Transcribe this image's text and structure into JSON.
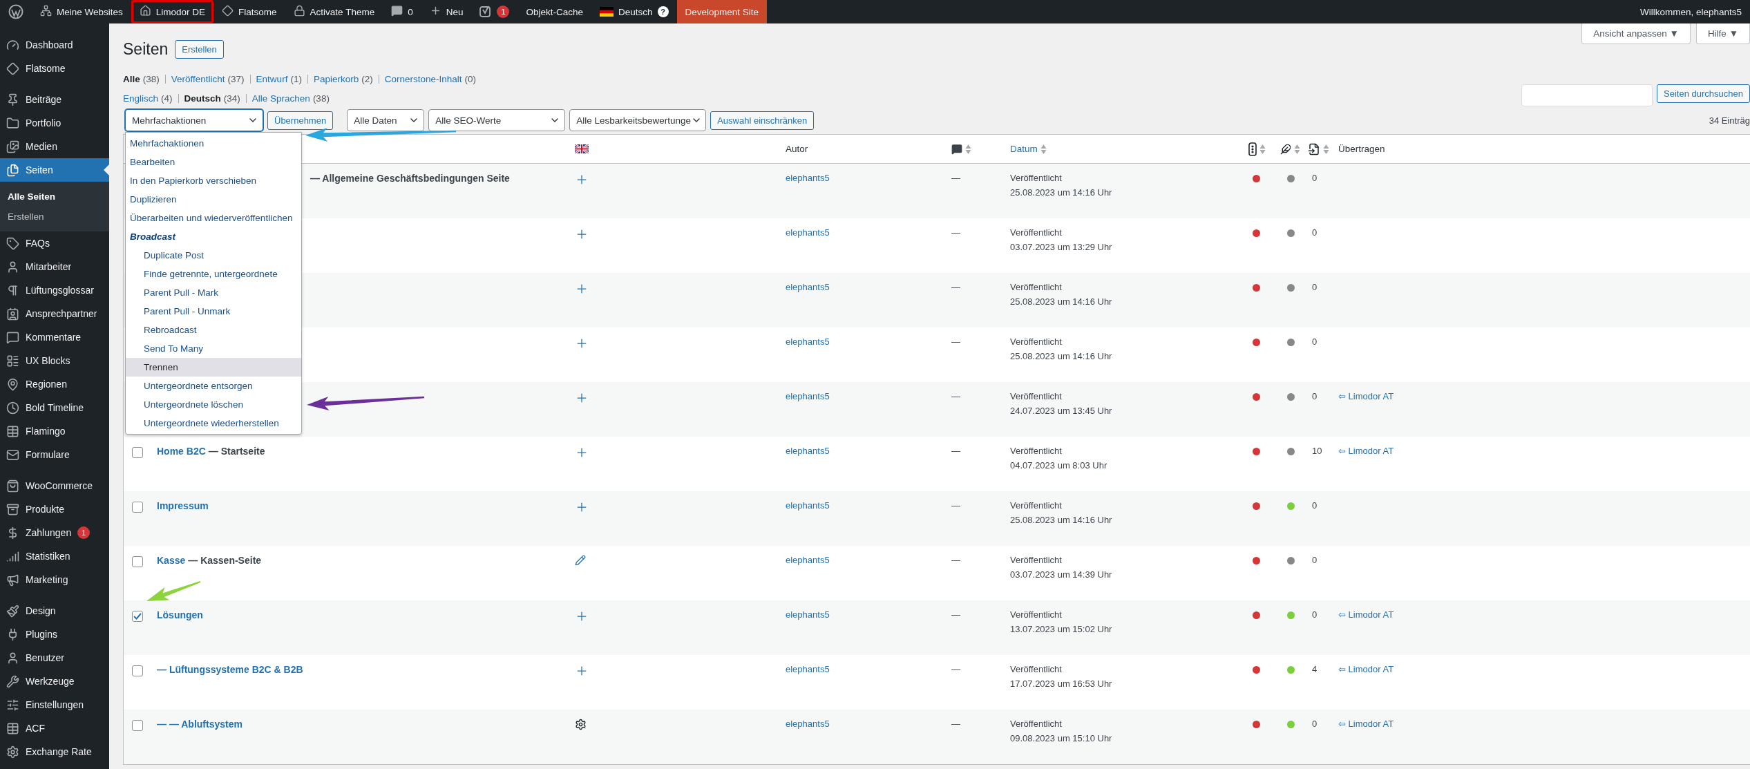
{
  "admin_bar": {
    "items": [
      {
        "kind": "logo",
        "highlighted": false
      },
      {
        "kind": "sites",
        "label": "Meine Websites",
        "highlighted": false
      },
      {
        "kind": "site",
        "label": "Limodor DE",
        "highlighted": true
      },
      {
        "kind": "theme",
        "label": "Flatsome",
        "highlighted": false
      },
      {
        "kind": "lock",
        "label": "Activate Theme",
        "highlighted": false
      },
      {
        "kind": "comments",
        "label": "0",
        "highlighted": false
      },
      {
        "kind": "new",
        "label": "Neu",
        "highlighted": false
      },
      {
        "kind": "seo",
        "badge": "1",
        "highlighted": false
      },
      {
        "kind": "text",
        "label": "Objekt-Cache",
        "highlighted": false
      },
      {
        "kind": "language",
        "label": "Deutsch",
        "help": "?",
        "highlighted": false
      },
      {
        "kind": "env",
        "label": "Development Site",
        "highlighted": false
      }
    ],
    "account": "Willkommen, elephants5"
  },
  "sidebar": {
    "groups": [
      [
        {
          "label": "Dashboard",
          "selected": false
        },
        {
          "label": "Flatsome",
          "selected": false
        }
      ],
      [
        {
          "label": "Beiträge",
          "selected": false
        },
        {
          "label": "Portfolio",
          "selected": false
        },
        {
          "label": "Medien",
          "selected": false
        },
        {
          "label": "Seiten",
          "selected": true,
          "children": [
            {
              "label": "Alle Seiten",
              "selected": true
            },
            {
              "label": "Erstellen",
              "selected": false
            }
          ]
        },
        {
          "label": "FAQs",
          "selected": false
        },
        {
          "label": "Mitarbeiter",
          "selected": false
        },
        {
          "label": "Lüftungsglossar",
          "selected": false
        },
        {
          "label": "Ansprechpartner",
          "selected": false
        },
        {
          "label": "Kommentare",
          "selected": false
        },
        {
          "label": "UX Blocks",
          "selected": false
        },
        {
          "label": "Regionen",
          "selected": false
        },
        {
          "label": "Bold Timeline",
          "selected": false
        },
        {
          "label": "Flamingo",
          "selected": false
        },
        {
          "label": "Formulare",
          "selected": false
        }
      ],
      [
        {
          "label": "WooCommerce",
          "selected": false
        },
        {
          "label": "Produkte",
          "selected": false
        },
        {
          "label": "Zahlungen",
          "selected": false,
          "badge": "1"
        },
        {
          "label": "Statistiken",
          "selected": false
        },
        {
          "label": "Marketing",
          "selected": false
        }
      ],
      [
        {
          "label": "Design",
          "selected": false
        },
        {
          "label": "Plugins",
          "selected": false
        },
        {
          "label": "Benutzer",
          "selected": false
        },
        {
          "label": "Werkzeuge",
          "selected": false
        },
        {
          "label": "Einstellungen",
          "selected": false
        },
        {
          "label": "ACF",
          "selected": false
        },
        {
          "label": "Exchange Rate",
          "selected": false
        }
      ]
    ]
  },
  "header": {
    "title": "Seiten",
    "add_button": "Erstellen",
    "screen_options": "Ansicht anpassen ▼",
    "help": "Hilfe ▼"
  },
  "views": [
    [
      {
        "label": "Alle",
        "count": "(38)",
        "selected": true
      },
      {
        "label": "Veröffentlicht",
        "count": "(37)",
        "selected": false
      },
      {
        "label": "Entwurf",
        "count": "(1)",
        "selected": false
      },
      {
        "label": "Papierkorb",
        "count": "(2)",
        "selected": false
      },
      {
        "label": "Cornerstone-Inhalt",
        "count": "(0)",
        "selected": false
      }
    ],
    [
      {
        "label": "Englisch",
        "count": "(4)",
        "selected": false
      },
      {
        "label": "Deutsch",
        "count": "(34)",
        "selected": true
      },
      {
        "label": "Alle Sprachen",
        "count": "(38)",
        "selected": false
      }
    ]
  ],
  "search": {
    "button": "Seiten durchsuchen"
  },
  "filters": {
    "bulk_select": "Mehrfachaktionen",
    "apply": "Übernehmen",
    "selects": [
      "Alle Daten",
      "Alle SEO-Werte",
      "Alle Lesbarkeitsbewertunge"
    ],
    "filter_button": "Auswahl einschränken",
    "count": "34 Einträg"
  },
  "bulk_menu": {
    "open": true,
    "options": [
      {
        "label": "Mehrfachaktionen",
        "kind": "option",
        "selected": false
      },
      {
        "label": "Bearbeiten",
        "kind": "option",
        "selected": false
      },
      {
        "label": "In den Papierkorb verschieben",
        "kind": "option",
        "selected": false
      },
      {
        "label": "Duplizieren",
        "kind": "option",
        "selected": false
      },
      {
        "label": "Überarbeiten und wiederveröffentlichen",
        "kind": "option",
        "selected": false
      },
      {
        "label": "Broadcast",
        "kind": "group",
        "selected": false
      },
      {
        "label": "Duplicate Post",
        "kind": "suboption",
        "selected": false
      },
      {
        "label": "Finde getrennte, untergeordnete",
        "kind": "suboption",
        "selected": false
      },
      {
        "label": "Parent Pull - Mark",
        "kind": "suboption",
        "selected": false
      },
      {
        "label": "Parent Pull - Unmark",
        "kind": "suboption",
        "selected": false
      },
      {
        "label": "Rebroadcast",
        "kind": "suboption",
        "selected": false
      },
      {
        "label": "Send To Many",
        "kind": "suboption",
        "selected": false
      },
      {
        "label": "Trennen",
        "kind": "suboption",
        "selected": true
      },
      {
        "label": "Untergeordnete entsorgen",
        "kind": "suboption",
        "selected": false
      },
      {
        "label": "Untergeordnete löschen",
        "kind": "suboption",
        "selected": false
      },
      {
        "label": "Untergeordnete wiederherstellen",
        "kind": "suboption",
        "selected": false
      }
    ]
  },
  "table": {
    "headers": {
      "author": "Autor",
      "date": "Datum",
      "transfer": "Übertragen"
    },
    "rows": [
      {
        "suffix": "— Allgemeine Geschäftsbedingungen Seite",
        "lang": {
          "kind": "add"
        },
        "author": "elephants5",
        "comments": "—",
        "status": "Veröffentlicht",
        "date": "25.08.2023 um 14:16 Uhr",
        "seo": {
          "color": "#d63638"
        },
        "readability": {
          "color": "#888888"
        },
        "count": "0"
      },
      {
        "lang": {
          "kind": "add"
        },
        "author": "elephants5",
        "comments": "—",
        "status": "Veröffentlicht",
        "date": "03.07.2023 um 13:29 Uhr",
        "seo": {
          "color": "#d63638"
        },
        "readability": {
          "color": "#888888"
        },
        "count": "0"
      },
      {
        "lang": {
          "kind": "add"
        },
        "author": "elephants5",
        "comments": "—",
        "status": "Veröffentlicht",
        "date": "25.08.2023 um 14:16 Uhr",
        "seo": {
          "color": "#d63638"
        },
        "readability": {
          "color": "#888888"
        },
        "count": "0"
      },
      {
        "lang": {
          "kind": "add"
        },
        "author": "elephants5",
        "comments": "—",
        "status": "Veröffentlicht",
        "date": "25.08.2023 um 14:16 Uhr",
        "seo": {
          "color": "#d63638"
        },
        "readability": {
          "color": "#888888"
        },
        "count": "0"
      },
      {
        "lang": {
          "kind": "add"
        },
        "author": "elephants5",
        "comments": "—",
        "status": "Veröffentlicht",
        "date": "24.07.2023 um 13:45 Uhr",
        "seo": {
          "color": "#d63638"
        },
        "readability": {
          "color": "#888888"
        },
        "count": "0",
        "transfer": "⇦ Limodor AT"
      },
      {
        "checked": false,
        "title": "Home B2C",
        "suffix": "— Startseite",
        "lang": {
          "kind": "add"
        },
        "author": "elephants5",
        "comments": "—",
        "status": "Veröffentlicht",
        "date": "04.07.2023 um 8:03 Uhr",
        "seo": {
          "color": "#d63638"
        },
        "readability": {
          "color": "#888888"
        },
        "count": "10",
        "transfer": "⇦ Limodor AT"
      },
      {
        "checked": false,
        "title": "Impressum",
        "lang": {
          "kind": "add"
        },
        "author": "elephants5",
        "comments": "—",
        "status": "Veröffentlicht",
        "date": "25.08.2023 um 14:16 Uhr",
        "seo": {
          "color": "#d63638"
        },
        "readability": {
          "color": "#7ad03a"
        },
        "count": "0"
      },
      {
        "checked": false,
        "title": "Kasse",
        "suffix": "— Kassen-Seite",
        "lang": {
          "kind": "edit"
        },
        "author": "elephants5",
        "comments": "—",
        "status": "Veröffentlicht",
        "date": "03.07.2023 um 14:39 Uhr",
        "seo": {
          "color": "#d63638"
        },
        "readability": {
          "color": "#888888"
        },
        "count": "0"
      },
      {
        "checked": true,
        "title": "Lösungen",
        "lang": {
          "kind": "add"
        },
        "author": "elephants5",
        "comments": "—",
        "status": "Veröffentlicht",
        "date": "13.07.2023 um 15:02 Uhr",
        "seo": {
          "color": "#d63638"
        },
        "readability": {
          "color": "#7ad03a"
        },
        "count": "0",
        "transfer": "⇦ Limodor AT"
      },
      {
        "checked": false,
        "title": "— Lüftungssysteme B2C & B2B",
        "lang": {
          "kind": "add"
        },
        "author": "elephants5",
        "comments": "—",
        "status": "Veröffentlicht",
        "date": "17.07.2023 um 16:53 Uhr",
        "seo": {
          "color": "#d63638"
        },
        "readability": {
          "color": "#7ad03a"
        },
        "count": "4",
        "transfer": "⇦ Limodor AT"
      },
      {
        "checked": false,
        "title": "— — Abluftsystem",
        "lang": {
          "kind": "settings"
        },
        "author": "elephants5",
        "comments": "—",
        "status": "Veröffentlicht",
        "date": "09.08.2023 um 15:10 Uhr",
        "seo": {
          "color": "#d63638"
        },
        "readability": {
          "color": "#7ad03a"
        },
        "count": "0",
        "transfer": "⇦ Limodor AT"
      }
    ]
  },
  "annotations": [
    {
      "color": "#29a8e0"
    },
    {
      "color": "#6b2f9a"
    },
    {
      "color": "#8cd33c"
    }
  ]
}
